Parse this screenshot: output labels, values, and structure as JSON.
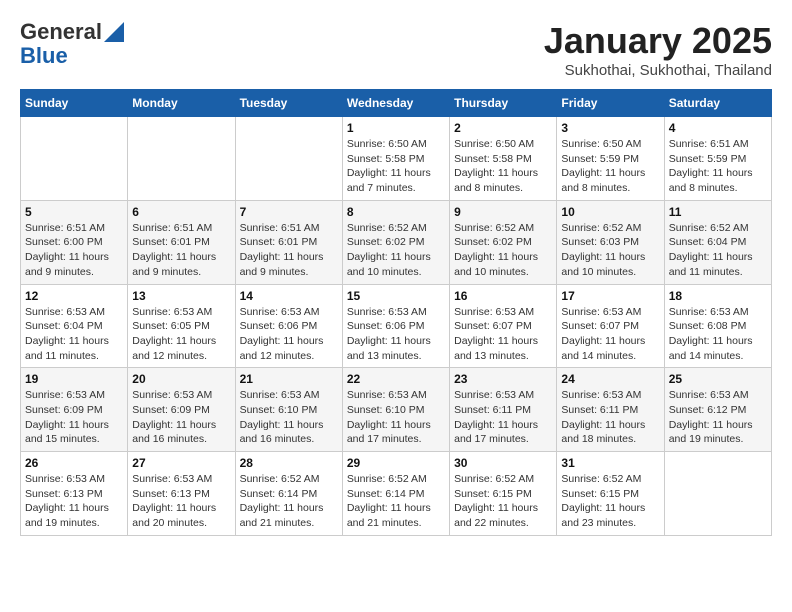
{
  "logo": {
    "general": "General",
    "blue": "Blue"
  },
  "header": {
    "month": "January 2025",
    "location": "Sukhothai, Sukhothai, Thailand"
  },
  "weekdays": [
    "Sunday",
    "Monday",
    "Tuesday",
    "Wednesday",
    "Thursday",
    "Friday",
    "Saturday"
  ],
  "weeks": [
    [
      {
        "day": "",
        "sunrise": "",
        "sunset": "",
        "daylight": ""
      },
      {
        "day": "",
        "sunrise": "",
        "sunset": "",
        "daylight": ""
      },
      {
        "day": "",
        "sunrise": "",
        "sunset": "",
        "daylight": ""
      },
      {
        "day": "1",
        "sunrise": "Sunrise: 6:50 AM",
        "sunset": "Sunset: 5:58 PM",
        "daylight": "Daylight: 11 hours and 7 minutes."
      },
      {
        "day": "2",
        "sunrise": "Sunrise: 6:50 AM",
        "sunset": "Sunset: 5:58 PM",
        "daylight": "Daylight: 11 hours and 8 minutes."
      },
      {
        "day": "3",
        "sunrise": "Sunrise: 6:50 AM",
        "sunset": "Sunset: 5:59 PM",
        "daylight": "Daylight: 11 hours and 8 minutes."
      },
      {
        "day": "4",
        "sunrise": "Sunrise: 6:51 AM",
        "sunset": "Sunset: 5:59 PM",
        "daylight": "Daylight: 11 hours and 8 minutes."
      }
    ],
    [
      {
        "day": "5",
        "sunrise": "Sunrise: 6:51 AM",
        "sunset": "Sunset: 6:00 PM",
        "daylight": "Daylight: 11 hours and 9 minutes."
      },
      {
        "day": "6",
        "sunrise": "Sunrise: 6:51 AM",
        "sunset": "Sunset: 6:01 PM",
        "daylight": "Daylight: 11 hours and 9 minutes."
      },
      {
        "day": "7",
        "sunrise": "Sunrise: 6:51 AM",
        "sunset": "Sunset: 6:01 PM",
        "daylight": "Daylight: 11 hours and 9 minutes."
      },
      {
        "day": "8",
        "sunrise": "Sunrise: 6:52 AM",
        "sunset": "Sunset: 6:02 PM",
        "daylight": "Daylight: 11 hours and 10 minutes."
      },
      {
        "day": "9",
        "sunrise": "Sunrise: 6:52 AM",
        "sunset": "Sunset: 6:02 PM",
        "daylight": "Daylight: 11 hours and 10 minutes."
      },
      {
        "day": "10",
        "sunrise": "Sunrise: 6:52 AM",
        "sunset": "Sunset: 6:03 PM",
        "daylight": "Daylight: 11 hours and 10 minutes."
      },
      {
        "day": "11",
        "sunrise": "Sunrise: 6:52 AM",
        "sunset": "Sunset: 6:04 PM",
        "daylight": "Daylight: 11 hours and 11 minutes."
      }
    ],
    [
      {
        "day": "12",
        "sunrise": "Sunrise: 6:53 AM",
        "sunset": "Sunset: 6:04 PM",
        "daylight": "Daylight: 11 hours and 11 minutes."
      },
      {
        "day": "13",
        "sunrise": "Sunrise: 6:53 AM",
        "sunset": "Sunset: 6:05 PM",
        "daylight": "Daylight: 11 hours and 12 minutes."
      },
      {
        "day": "14",
        "sunrise": "Sunrise: 6:53 AM",
        "sunset": "Sunset: 6:06 PM",
        "daylight": "Daylight: 11 hours and 12 minutes."
      },
      {
        "day": "15",
        "sunrise": "Sunrise: 6:53 AM",
        "sunset": "Sunset: 6:06 PM",
        "daylight": "Daylight: 11 hours and 13 minutes."
      },
      {
        "day": "16",
        "sunrise": "Sunrise: 6:53 AM",
        "sunset": "Sunset: 6:07 PM",
        "daylight": "Daylight: 11 hours and 13 minutes."
      },
      {
        "day": "17",
        "sunrise": "Sunrise: 6:53 AM",
        "sunset": "Sunset: 6:07 PM",
        "daylight": "Daylight: 11 hours and 14 minutes."
      },
      {
        "day": "18",
        "sunrise": "Sunrise: 6:53 AM",
        "sunset": "Sunset: 6:08 PM",
        "daylight": "Daylight: 11 hours and 14 minutes."
      }
    ],
    [
      {
        "day": "19",
        "sunrise": "Sunrise: 6:53 AM",
        "sunset": "Sunset: 6:09 PM",
        "daylight": "Daylight: 11 hours and 15 minutes."
      },
      {
        "day": "20",
        "sunrise": "Sunrise: 6:53 AM",
        "sunset": "Sunset: 6:09 PM",
        "daylight": "Daylight: 11 hours and 16 minutes."
      },
      {
        "day": "21",
        "sunrise": "Sunrise: 6:53 AM",
        "sunset": "Sunset: 6:10 PM",
        "daylight": "Daylight: 11 hours and 16 minutes."
      },
      {
        "day": "22",
        "sunrise": "Sunrise: 6:53 AM",
        "sunset": "Sunset: 6:10 PM",
        "daylight": "Daylight: 11 hours and 17 minutes."
      },
      {
        "day": "23",
        "sunrise": "Sunrise: 6:53 AM",
        "sunset": "Sunset: 6:11 PM",
        "daylight": "Daylight: 11 hours and 17 minutes."
      },
      {
        "day": "24",
        "sunrise": "Sunrise: 6:53 AM",
        "sunset": "Sunset: 6:11 PM",
        "daylight": "Daylight: 11 hours and 18 minutes."
      },
      {
        "day": "25",
        "sunrise": "Sunrise: 6:53 AM",
        "sunset": "Sunset: 6:12 PM",
        "daylight": "Daylight: 11 hours and 19 minutes."
      }
    ],
    [
      {
        "day": "26",
        "sunrise": "Sunrise: 6:53 AM",
        "sunset": "Sunset: 6:13 PM",
        "daylight": "Daylight: 11 hours and 19 minutes."
      },
      {
        "day": "27",
        "sunrise": "Sunrise: 6:53 AM",
        "sunset": "Sunset: 6:13 PM",
        "daylight": "Daylight: 11 hours and 20 minutes."
      },
      {
        "day": "28",
        "sunrise": "Sunrise: 6:52 AM",
        "sunset": "Sunset: 6:14 PM",
        "daylight": "Daylight: 11 hours and 21 minutes."
      },
      {
        "day": "29",
        "sunrise": "Sunrise: 6:52 AM",
        "sunset": "Sunset: 6:14 PM",
        "daylight": "Daylight: 11 hours and 21 minutes."
      },
      {
        "day": "30",
        "sunrise": "Sunrise: 6:52 AM",
        "sunset": "Sunset: 6:15 PM",
        "daylight": "Daylight: 11 hours and 22 minutes."
      },
      {
        "day": "31",
        "sunrise": "Sunrise: 6:52 AM",
        "sunset": "Sunset: 6:15 PM",
        "daylight": "Daylight: 11 hours and 23 minutes."
      },
      {
        "day": "",
        "sunrise": "",
        "sunset": "",
        "daylight": ""
      }
    ]
  ]
}
